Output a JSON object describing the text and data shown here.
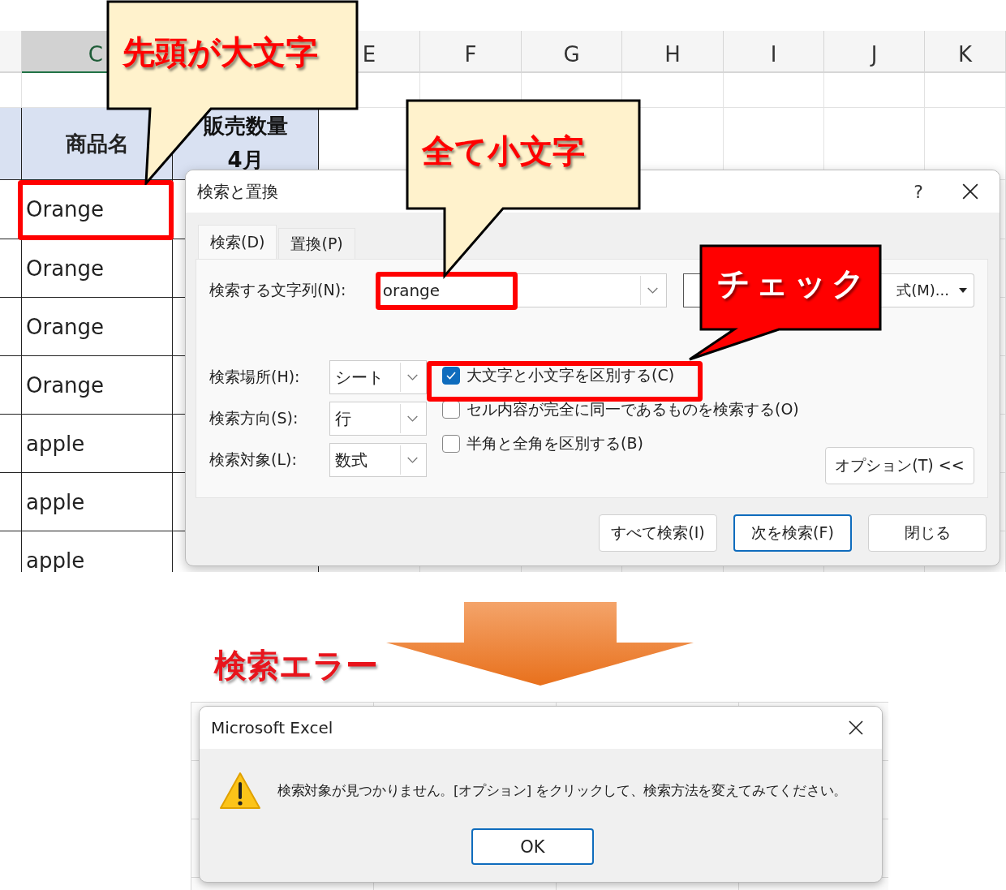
{
  "spreadsheet": {
    "columns": [
      {
        "label": "C",
        "selected": true
      },
      {
        "label": "E",
        "selected": false
      },
      {
        "label": "F",
        "selected": false
      },
      {
        "label": "G",
        "selected": false
      },
      {
        "label": "H",
        "selected": false
      },
      {
        "label": "I",
        "selected": false
      },
      {
        "label": "J",
        "selected": false
      },
      {
        "label": "K",
        "selected": false
      }
    ],
    "header": {
      "product": "商品名",
      "sales": [
        "販売数量",
        "4月"
      ]
    },
    "rows": [
      "Orange",
      "Orange",
      "Orange",
      "Orange",
      "apple",
      "apple",
      "apple"
    ]
  },
  "find_dialog": {
    "title": "検索と置換",
    "help": "?",
    "tabs": [
      {
        "label": "検索(D)",
        "selected": true
      },
      {
        "label": "置換(P)",
        "selected": false
      }
    ],
    "search_label": "検索する文字列(N):",
    "search_value": "orange",
    "format_button": "式(M)...",
    "selects": [
      {
        "label": "検索場所(H):",
        "value": "シート"
      },
      {
        "label": "検索方向(S):",
        "value": "行"
      },
      {
        "label": "検索対象(L):",
        "value": "数式"
      }
    ],
    "checkboxes": [
      {
        "label": "大文字と小文字を区別する(C)",
        "checked": true
      },
      {
        "label": "セル内容が完全に同一であるものを検索する(O)",
        "checked": false
      },
      {
        "label": "半角と全角を区別する(B)",
        "checked": false
      }
    ],
    "options_button": "オプション(T) <<",
    "buttons": [
      {
        "label": "すべて検索(I)",
        "default": false
      },
      {
        "label": "次を検索(F)",
        "default": true
      },
      {
        "label": "閉じる",
        "default": false
      }
    ]
  },
  "callouts": [
    {
      "text": "先頭が大文字",
      "kind": "note"
    },
    {
      "text": "全て小文字",
      "kind": "note"
    },
    {
      "text": "チェック",
      "kind": "alert"
    }
  ],
  "transition": {
    "label": "検索エラー"
  },
  "error_dialog": {
    "title": "Microsoft Excel",
    "message": "検索対象が見つかりません。[オプション] をクリックして、検索方法を変えてみてください。",
    "button": "OK"
  }
}
